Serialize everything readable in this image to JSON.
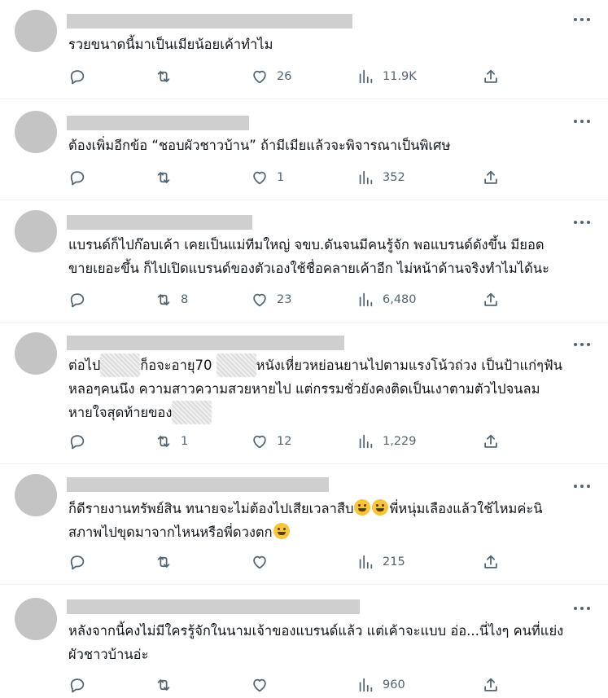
{
  "posts": [
    {
      "text": [
        "รวยขนาดนี้มาเป็นเมียน้อยเค้าทำไม"
      ],
      "reply_count": "",
      "retweet_count": "",
      "like_count": "26",
      "view_count": "11.9K"
    },
    {
      "text": [
        "ต้องเพิ่มอีกข้อ “ชอบผัวชาวบ้าน” ถ้ามีเมียแล้วจะพิจารณาเป็นพิเศษ"
      ],
      "reply_count": "",
      "retweet_count": "",
      "like_count": "1",
      "view_count": "352"
    },
    {
      "text": [
        "แบรนด์ก็ไปก๊อบเค้า เคยเป็นแม่ทีมใหญ่ จขบ.ดันจนมีคนรู้จัก พอแบรนด์ดังขึ้น มียอด",
        "ขายเยอะขึ้น ก็ไปเปิดแบรนด์ของตัวเองใช้ชื่อคลายเค้าอีก ไม่หน้าด้านจริงทำไมได้นะ"
      ],
      "reply_count": "",
      "retweet_count": "8",
      "like_count": "23",
      "view_count": "6,480"
    },
    {
      "text_parts": {
        "l1a": "ต่อไป",
        "l1b": "ก็อจะอายุ70",
        "l1c": "หนังเหี่ยวหย่อนยานไปตามแรงโน้วถ่วง เป็นป้าแก่ๆฟัน",
        "l2": "หลอๆคนนึง ความสาวความสวยหายไป แต่กรรมชั่วยังคงติดเป็นเงาตามตัวไปจนลม",
        "l3": "หายใจสุดท้ายของ"
      },
      "reply_count": "",
      "retweet_count": "1",
      "like_count": "12",
      "view_count": "1,229"
    },
    {
      "text_parts": {
        "l1a": "ก็ดีรายงานทรัพย์สิน ทนายจะไม่ต้องไปเสียเวลาสืบ",
        "l1b": "พี่หนุ่มเลืองแล้วใช้ไหมค่ะนิ",
        "l2": "สภาพไปขุดมาจากไหนหรือพี่ดวงตก"
      },
      "reply_count": "",
      "retweet_count": "",
      "like_count": "",
      "view_count": "215"
    },
    {
      "text": [
        "หลังจากนี้คงไม่มีใครรู้จักในนามเจ้าของแบรนด์แล้ว แต่เค้าจะแบบ อ่อ...นี่ไงๆ คนที่แย่ง",
        "ผัวชาวบ้านอ่ะ"
      ],
      "reply_count": "",
      "retweet_count": "",
      "like_count": "",
      "view_count": "960"
    }
  ],
  "icons": {
    "reply": "reply-icon",
    "retweet": "retweet-icon",
    "like": "heart-icon",
    "views": "views-icon",
    "share": "share-icon",
    "more": "more-icon"
  }
}
